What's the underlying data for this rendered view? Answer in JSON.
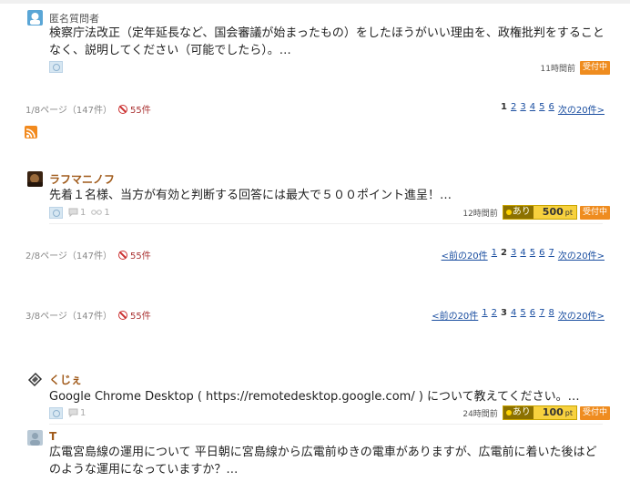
{
  "q1": {
    "asker": "匿名質問者",
    "text": "検察庁法改正（定年延長など、国会審議が始まったもの）をしたほうがいい理由を、政権批判をすることなく、説明してください（可能でしたら）。…",
    "time": "11時間前",
    "status": "受付中"
  },
  "pagebar1": {
    "info": "1/8ページ（147件）",
    "ng": "55件",
    "current": "1",
    "pages": [
      "2",
      "3",
      "4",
      "5",
      "6"
    ],
    "next": "次の20件>"
  },
  "q2": {
    "asker": "ラフマニノフ",
    "text": "先着１名様、当方が有効と判断する回答には最大で５００ポイント進呈！…",
    "answers": "1",
    "views": "1",
    "time": "12時間前",
    "points_label": "あり",
    "points_value": "500",
    "points_unit": "pt",
    "status": "受付中"
  },
  "pagebar2": {
    "info": "2/8ページ（147件）",
    "ng": "55件",
    "prev": "<前の20件",
    "pages_before": [
      "1"
    ],
    "current": "2",
    "pages": [
      "3",
      "4",
      "5",
      "6",
      "7"
    ],
    "next": "次の20件>"
  },
  "pagebar3": {
    "info": "3/8ページ（147件）",
    "ng": "55件",
    "prev": "<前の20件",
    "pages_before": [
      "1",
      "2"
    ],
    "current": "3",
    "pages": [
      "4",
      "5",
      "6",
      "7",
      "8"
    ],
    "next": "次の20件>"
  },
  "q3": {
    "asker": "くじぇ",
    "text": "Google Chrome Desktop ( https://remotedesktop.google.com/ ) について教えてください。…",
    "answers": "1",
    "time": "24時間前",
    "points_label": "あり",
    "points_value": "100",
    "points_unit": "pt",
    "status": "受付中"
  },
  "q4": {
    "asker": "T",
    "text": "広電宮島線の運用について 平日朝に宮島線から広電前ゆきの電車がありますが、広電前に着いた後はどのような運用になっていますか？…"
  }
}
